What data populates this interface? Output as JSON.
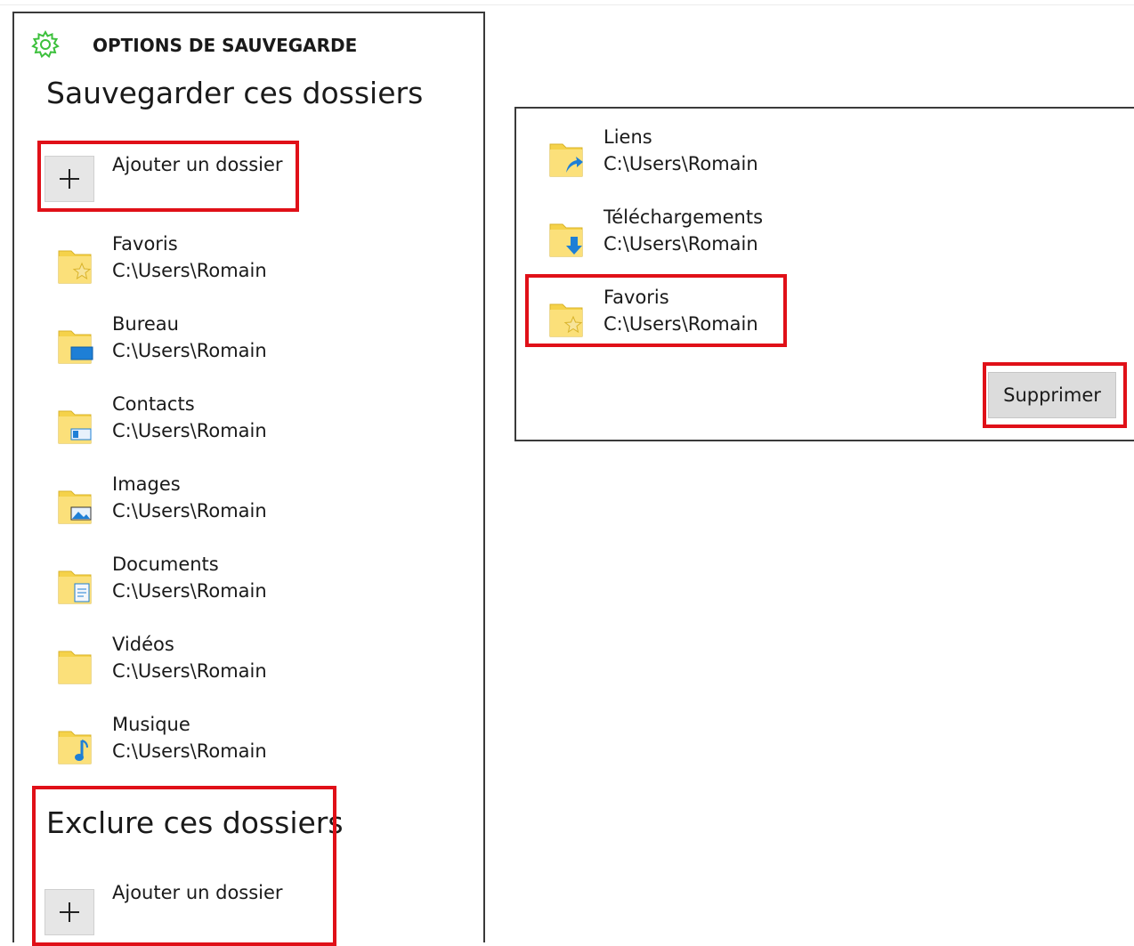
{
  "left": {
    "header_title": "OPTIONS DE SAUVEGARDE",
    "backup_section_title": "Sauvegarder ces dossiers",
    "add_folder_label": "Ajouter un dossier",
    "folders": [
      {
        "name": "Favoris",
        "path": "C:\\Users\\Romain",
        "icon": "favorites-folder-icon"
      },
      {
        "name": "Bureau",
        "path": "C:\\Users\\Romain",
        "icon": "desktop-folder-icon"
      },
      {
        "name": "Contacts",
        "path": "C:\\Users\\Romain",
        "icon": "contacts-folder-icon"
      },
      {
        "name": "Images",
        "path": "C:\\Users\\Romain",
        "icon": "pictures-folder-icon"
      },
      {
        "name": "Documents",
        "path": "C:\\Users\\Romain",
        "icon": "documents-folder-icon"
      },
      {
        "name": "Vidéos",
        "path": "C:\\Users\\Romain",
        "icon": "videos-folder-icon"
      },
      {
        "name": "Musique",
        "path": "C:\\Users\\Romain",
        "icon": "music-folder-icon"
      }
    ],
    "exclude_section_title": "Exclure ces dossiers",
    "exclude_add_folder_label": "Ajouter un dossier"
  },
  "right": {
    "folders": [
      {
        "name": "Liens",
        "path": "C:\\Users\\Romain",
        "icon": "links-folder-icon"
      },
      {
        "name": "Téléchargements",
        "path": "C:\\Users\\Romain",
        "icon": "downloads-folder-icon"
      },
      {
        "name": "Favoris",
        "path": "C:\\Users\\Romain",
        "icon": "favorites-folder-icon"
      }
    ],
    "remove_label": "Supprimer"
  },
  "colors": {
    "highlight": "#e01018",
    "gear": "#3cc03c",
    "folder": "#f5d24a",
    "accent_blue": "#1e7fd6"
  }
}
